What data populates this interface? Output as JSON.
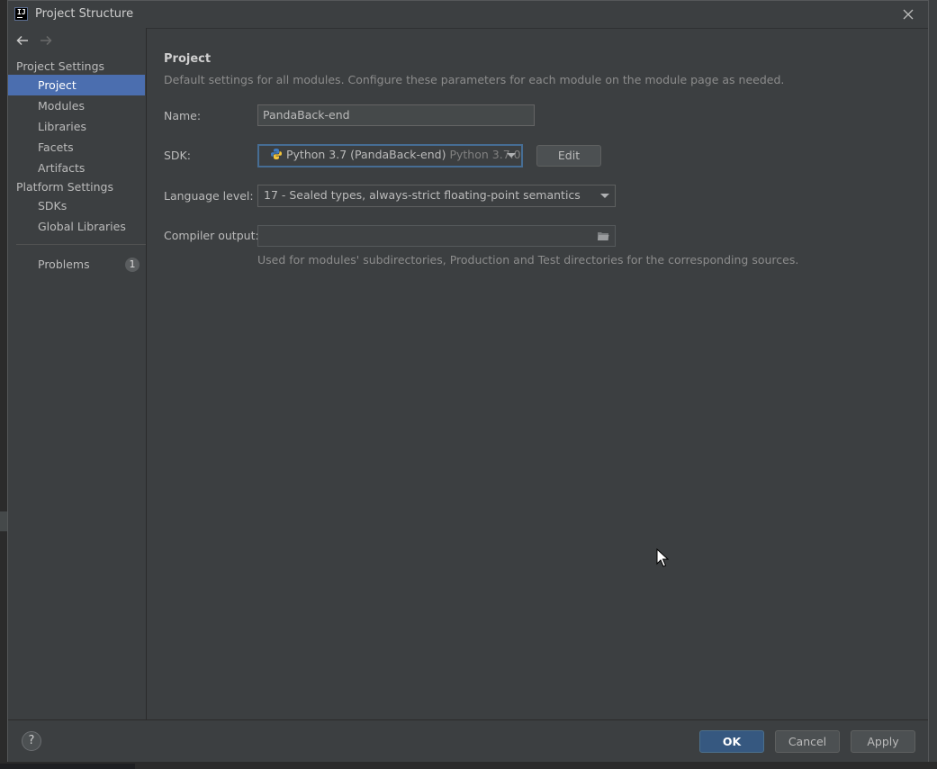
{
  "window": {
    "title": "Project Structure"
  },
  "sidebar": {
    "project_settings_header": "Project Settings",
    "project_settings_items": [
      {
        "label": "Project",
        "selected": true
      },
      {
        "label": "Modules"
      },
      {
        "label": "Libraries"
      },
      {
        "label": "Facets"
      },
      {
        "label": "Artifacts"
      }
    ],
    "platform_settings_header": "Platform Settings",
    "platform_settings_items": [
      {
        "label": "SDKs"
      },
      {
        "label": "Global Libraries"
      }
    ],
    "problems": {
      "label": "Problems",
      "count": "1"
    }
  },
  "main": {
    "heading": "Project",
    "description": "Default settings for all modules. Configure these parameters for each module on the module page as needed.",
    "name": {
      "label": "Name:",
      "value": "PandaBack-end"
    },
    "sdk": {
      "label": "SDK:",
      "value": "Python 3.7 (PandaBack-end)",
      "version": "Python 3.7.0",
      "edit_label": "Edit"
    },
    "language_level": {
      "label": "Language level:",
      "value": "17 - Sealed types, always-strict floating-point semantics"
    },
    "compiler_output": {
      "label": "Compiler output:",
      "value": "",
      "hint": "Used for modules' subdirectories, Production and Test directories for the corresponding sources."
    }
  },
  "footer": {
    "help_label": "?",
    "ok_label": "OK",
    "cancel_label": "Cancel",
    "apply_label": "Apply"
  },
  "colors": {
    "accent": "#4b6eaf",
    "background": "#3c3f41",
    "primary_button": "#365880"
  }
}
